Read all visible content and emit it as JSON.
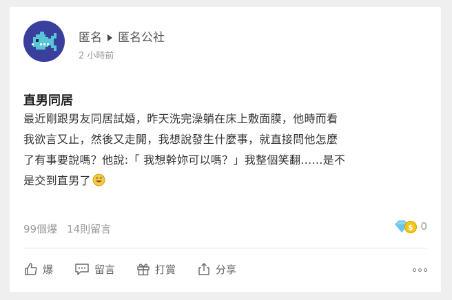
{
  "post": {
    "author": "匿名",
    "board": "匿名公社",
    "time": "2 小時前",
    "title": "直男同居",
    "body_lines": [
      "最近剛跟男友同居試婚，昨天洗完澡躺在床上敷面膜，他時而看",
      "我欲言又止，然後又走開，我想說發生什麼事，就直接問他怎麼",
      "了有事要說嗎？他說:「 我想幹妳可以嗎？」我整個笑翻......是不",
      "是交到直男了"
    ],
    "emoji": "sweat-smile-emoji"
  },
  "stats": {
    "likes": "99個爆",
    "comments": "14則留言",
    "reward_count": "0"
  },
  "actions": {
    "like": "爆",
    "comment": "留言",
    "tip": "打賞",
    "share": "分享"
  },
  "colors": {
    "avatar_bg": "#3a3f9e",
    "fish": "#57c6d6",
    "background": "#efefef"
  }
}
